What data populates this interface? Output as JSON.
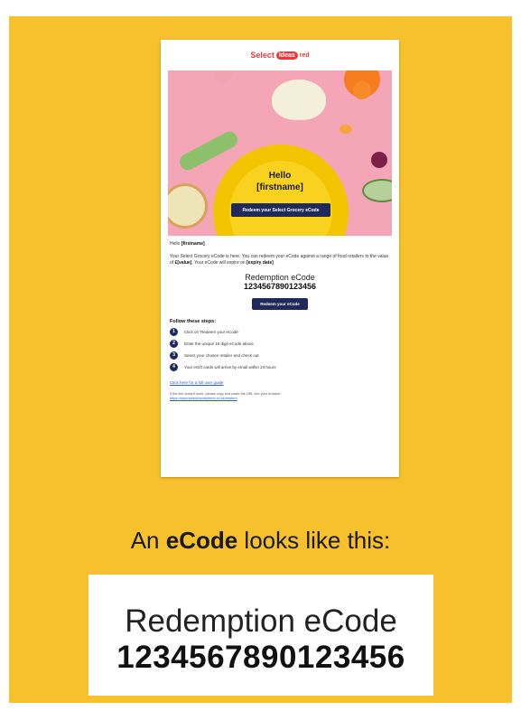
{
  "email": {
    "logo": {
      "part1": "Select",
      "part2": "Ideas",
      "part3": "red"
    },
    "hero": {
      "title_line1": "Hello",
      "title_line2": "[firstname]",
      "button_label": "Redeem your Select Grocery eCode"
    },
    "greeting_prefix": "Hello ",
    "greeting_name": "[firstname]",
    "body_text_a": "Your Select Grocery eCode is here. You can redeem your eCode against a range of food retailers to the value of ",
    "body_value": "£[value]",
    "body_text_b": ". Your eCode will expire on ",
    "body_expiry": "[expiry date]",
    "code_label": "Redemption eCode",
    "code_number": "1234567890123456",
    "redeem_button_label": "Redeem your eCode",
    "steps_title": "Follow these steps:",
    "steps": [
      {
        "num": "1",
        "text": "Click on 'Redeem your eCode'"
      },
      {
        "num": "2",
        "text": "Enter the unique 16 digit eCode above"
      },
      {
        "num": "3",
        "text": "Select your chosen retailer and check out"
      },
      {
        "num": "4",
        "text": "Your eGift cards will arrive by email within 24 hours"
      }
    ],
    "guide_link": "Click here for a full user guide",
    "fallback_text": "If the link doesn't work, please copy and paste the URL into your browser:",
    "fallback_url": "https://www.selectfoodredeem.co.uk/redeem"
  },
  "caption": {
    "prefix": "An ",
    "bold": "eCode",
    "suffix": " looks like this:"
  },
  "code_card": {
    "label": "Redemption eCode",
    "number": "1234567890123456"
  },
  "colors": {
    "background": "#f7c12e",
    "navy": "#1f2a5a",
    "brand_red": "#e83a3a",
    "hero_pink": "#f4a6b6",
    "plate_yellow": "#f2c500"
  }
}
